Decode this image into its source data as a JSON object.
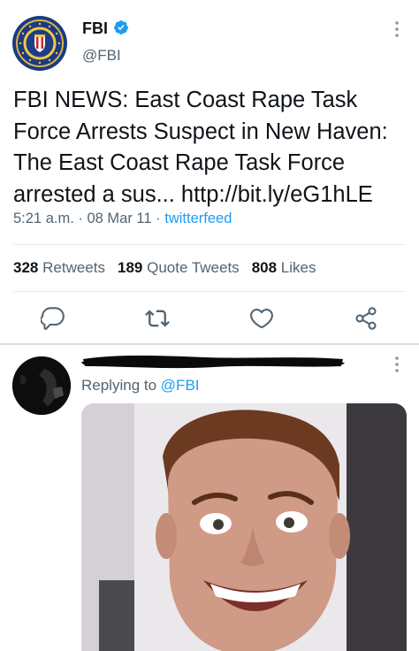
{
  "tweet": {
    "author": {
      "display_name": "FBI",
      "handle": "@FBI",
      "verified": true,
      "avatar_icon": "fbi-seal-icon"
    },
    "text": "FBI NEWS: East Coast Rape Task\nForce Arrests Suspect in New Haven:\nThe East Coast Rape Task Force\narrested a sus... http://bit.ly/eG1hLE",
    "time": "5:21 a.m.",
    "date": "08 Mar 11",
    "source": "twitterfeed",
    "separator": "·",
    "stats": {
      "retweets_count": "328",
      "retweets_label": "Retweets",
      "quote_count": "189",
      "quote_label": "Quote Tweets",
      "likes_count": "808",
      "likes_label": "Likes"
    },
    "actions": [
      "reply-icon",
      "retweet-icon",
      "like-icon",
      "share-icon"
    ]
  },
  "reply": {
    "replying_prefix": "Replying to",
    "replying_to": "@FBI",
    "name_redacted": true
  },
  "colors": {
    "text": "#0f1419",
    "secondary": "#536471",
    "link": "#1d9bf0",
    "verified": "#1d9bf0",
    "divider": "#e6e9ec"
  }
}
